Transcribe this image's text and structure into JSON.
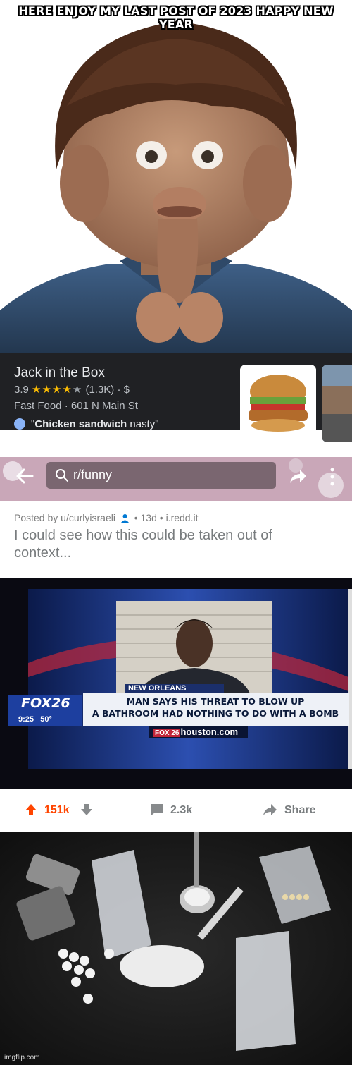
{
  "meme": {
    "caption": "HERE ENJOY MY LAST POST OF 2023 HAPPY NEW YEAR"
  },
  "maps_listing": {
    "name": "Jack in the Box",
    "rating": "3.9",
    "stars_filled": 4,
    "review_count": "(1.3K)",
    "price": "· $",
    "category": "Fast Food · 601 N Main St",
    "review_quote_open": "\"",
    "review_quote_bold": "Chicken sandwich",
    "review_quote_rest": " nasty\""
  },
  "reddit": {
    "subreddit": "r/funny",
    "posted_by_prefix": "Posted by u/curlyisraeli",
    "posted_by_suffix": "• 13d • i.redd.it",
    "post_title": "I could see how this could be taken out of context...",
    "upvotes": "151k",
    "comments": "2.3k",
    "share_label": "Share",
    "colors": {
      "upvote": "#ff4500",
      "muted": "#787c7e"
    }
  },
  "news": {
    "location": "NEW ORLEANS",
    "headline_line1": "MAN SAYS HIS THREAT TO BLOW UP",
    "headline_line2": "A BATHROOM HAD NOTHING TO DO WITH A BOMB",
    "channel": "FOX26",
    "time": "9:25",
    "temperature": "50°",
    "site": "houston.com",
    "site_prefix": "FOX 26"
  },
  "footer": {
    "watermark": "imgflip.com"
  }
}
